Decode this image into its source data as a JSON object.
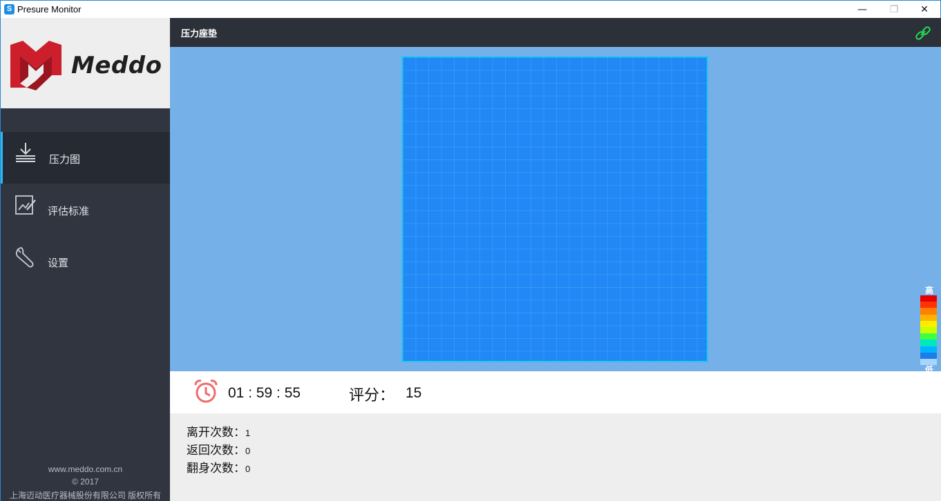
{
  "window": {
    "title": "Presure Monitor",
    "minimize": "—",
    "maximize": "❐",
    "close": "✕"
  },
  "logo": {
    "text": "Meddo",
    "brand_color": "#cc1e2b"
  },
  "sidebar": {
    "items": [
      {
        "label": "压力图",
        "icon": "download-tray-icon",
        "active": true
      },
      {
        "label": "评估标准",
        "icon": "edit-chart-icon",
        "active": false
      },
      {
        "label": "设置",
        "icon": "wrench-icon",
        "active": false
      }
    ],
    "footer": {
      "website": "www.meddo.com.cn",
      "copyright": "© 2017",
      "company": "上海迈动医疗器械股份有限公司 版权所有"
    }
  },
  "header": {
    "title": "压力座垫",
    "status_icon": "link-icon",
    "status_color": "#22dd55"
  },
  "pressure_map": {
    "rows": 24,
    "cols": 24,
    "base_color": "#2189f5",
    "border_color": "#25c8f0"
  },
  "legend": {
    "high_label": "高",
    "low_label": "低",
    "colors": [
      "#e60000",
      "#ff3300",
      "#ff8000",
      "#ffb300",
      "#ffee00",
      "#c8ff00",
      "#40ff40",
      "#00e8c0",
      "#00b4ff",
      "#1a7de8",
      "#a8d4ff"
    ]
  },
  "stats": {
    "timer": "01 : 59 : 55",
    "score_label": "评分：",
    "score_value": "15",
    "clock_color": "#f06a6a"
  },
  "counts": [
    {
      "label": "离开次数：",
      "value": "1"
    },
    {
      "label": "返回次数：",
      "value": "0"
    },
    {
      "label": "翻身次数：",
      "value": "0"
    }
  ]
}
